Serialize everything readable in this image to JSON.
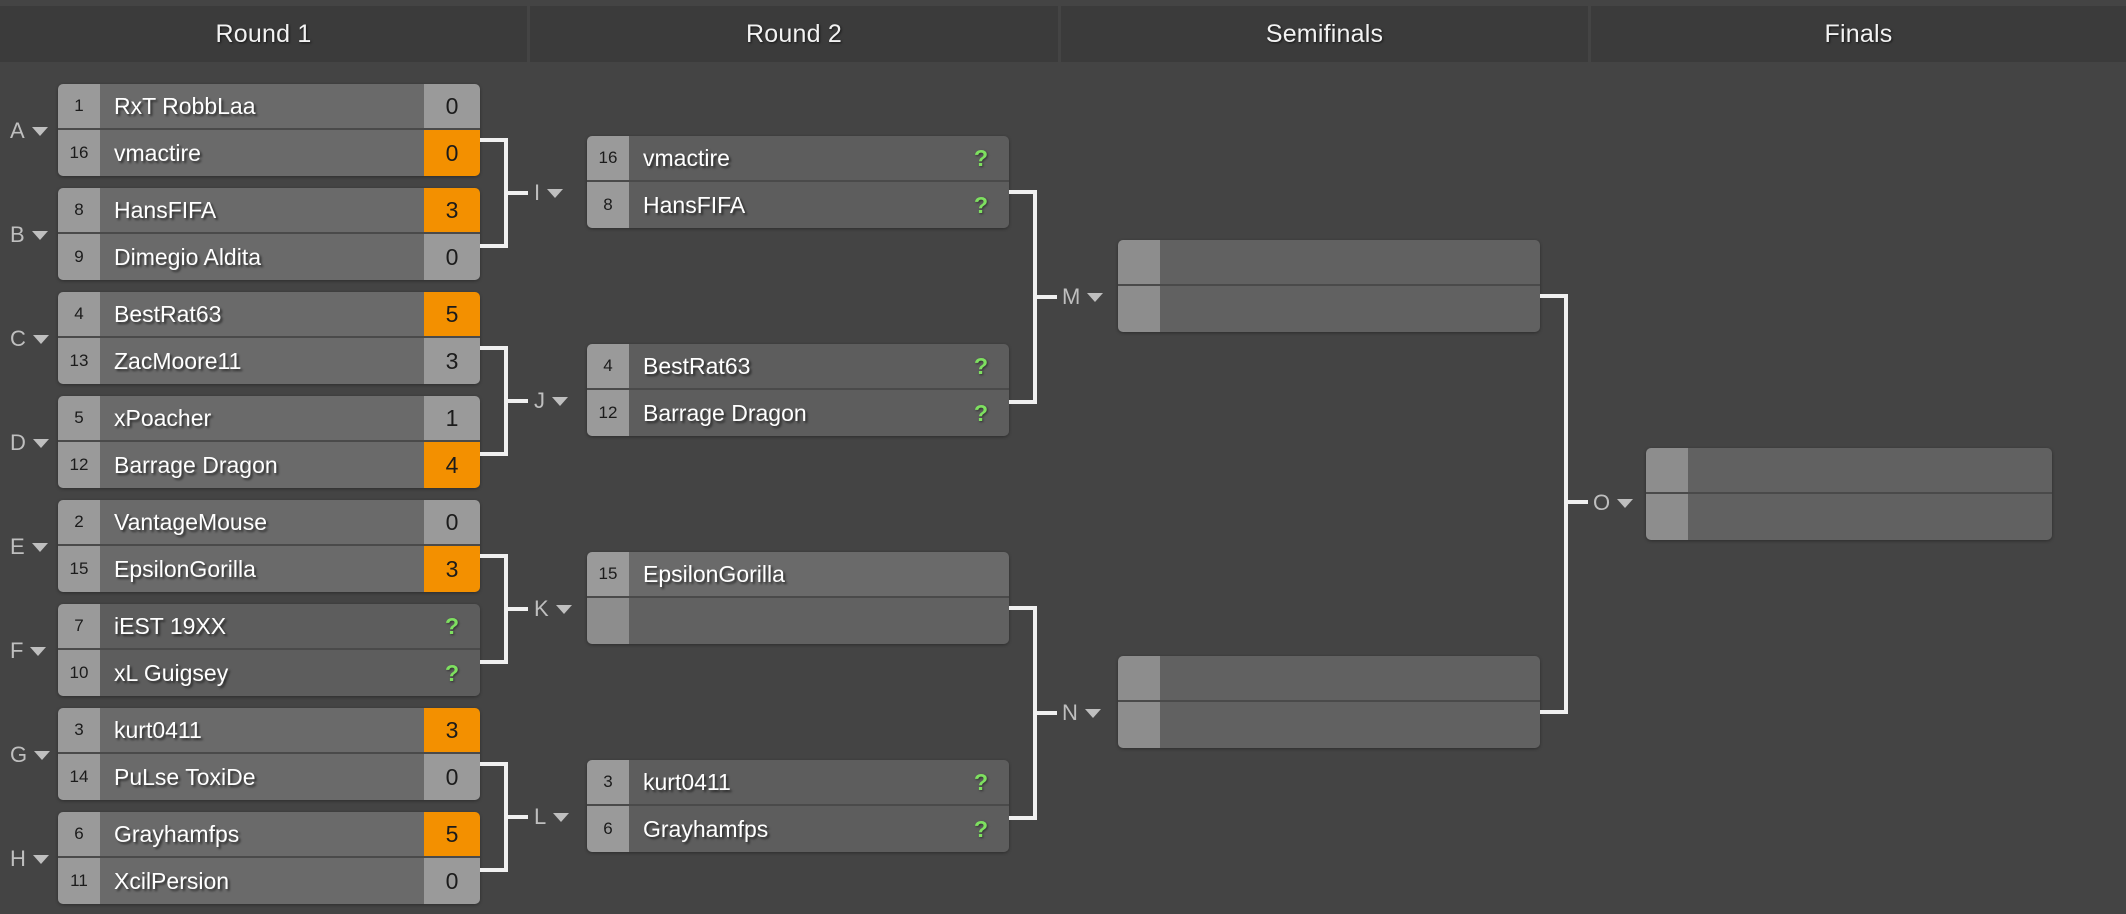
{
  "headers": [
    {
      "label": "Round 1"
    },
    {
      "label": "Round 2"
    },
    {
      "label": "Semifinals"
    },
    {
      "label": "Finals"
    }
  ],
  "group_labels": [
    {
      "letter": "A"
    },
    {
      "letter": "B"
    },
    {
      "letter": "C"
    },
    {
      "letter": "D"
    },
    {
      "letter": "E"
    },
    {
      "letter": "F"
    },
    {
      "letter": "G"
    },
    {
      "letter": "H"
    }
  ],
  "match_labels": [
    {
      "letter": "I"
    },
    {
      "letter": "J"
    },
    {
      "letter": "K"
    },
    {
      "letter": "L"
    },
    {
      "letter": "M"
    },
    {
      "letter": "N"
    },
    {
      "letter": "O"
    }
  ],
  "unknown_score": "?",
  "colors": {
    "page_background": "#444444",
    "header_background": "#3b3b3b",
    "seed_cell": "#9a9a9a",
    "name_cell": "#6a6a6a",
    "score_cell": "#9a9a9a",
    "winner_score": "#f39000",
    "pending_cell": "#5a5a5a",
    "pending_text": "#7ee060",
    "connector_line": "#f0f0f0",
    "label_text": "#bfbfbf"
  },
  "round1": {
    "matches": [
      {
        "group": "A",
        "top": {
          "seed": "1",
          "name": "RxT RobbLaa",
          "score": "0",
          "winner": false
        },
        "bottom": {
          "seed": "16",
          "name": "vmactire",
          "score": "0",
          "winner": true
        }
      },
      {
        "group": "B",
        "top": {
          "seed": "8",
          "name": "HansFIFA",
          "score": "3",
          "winner": true
        },
        "bottom": {
          "seed": "9",
          "name": "Dimegio Aldita",
          "score": "0",
          "winner": false
        }
      },
      {
        "group": "C",
        "top": {
          "seed": "4",
          "name": "BestRat63",
          "score": "5",
          "winner": true
        },
        "bottom": {
          "seed": "13",
          "name": "ZacMoore11",
          "score": "3",
          "winner": false
        }
      },
      {
        "group": "D",
        "top": {
          "seed": "5",
          "name": "xPoacher",
          "score": "1",
          "winner": false
        },
        "bottom": {
          "seed": "12",
          "name": "Barrage Dragon",
          "score": "4",
          "winner": true
        }
      },
      {
        "group": "E",
        "top": {
          "seed": "2",
          "name": "VantageMouse",
          "score": "0",
          "winner": false
        },
        "bottom": {
          "seed": "15",
          "name": "EpsilonGorilla",
          "score": "3",
          "winner": true
        }
      },
      {
        "group": "F",
        "top": {
          "seed": "7",
          "name": "iEST 19XX",
          "score": "?",
          "winner": false,
          "pending": true
        },
        "bottom": {
          "seed": "10",
          "name": "xL Guigsey",
          "score": "?",
          "winner": false,
          "pending": true
        }
      },
      {
        "group": "G",
        "top": {
          "seed": "3",
          "name": "kurt0411",
          "score": "3",
          "winner": true
        },
        "bottom": {
          "seed": "14",
          "name": "PuLse ToxiDe",
          "score": "0",
          "winner": false
        }
      },
      {
        "group": "H",
        "top": {
          "seed": "6",
          "name": "Grayhamfps",
          "score": "5",
          "winner": true
        },
        "bottom": {
          "seed": "11",
          "name": "XcilPersion",
          "score": "0",
          "winner": false
        }
      }
    ]
  },
  "round2": {
    "matches": [
      {
        "letter": "I",
        "top": {
          "seed": "16",
          "name": "vmactire",
          "score": "?",
          "pending": true
        },
        "bottom": {
          "seed": "8",
          "name": "HansFIFA",
          "score": "?",
          "pending": true
        }
      },
      {
        "letter": "J",
        "top": {
          "seed": "4",
          "name": "BestRat63",
          "score": "?",
          "pending": true
        },
        "bottom": {
          "seed": "12",
          "name": "Barrage Dragon",
          "score": "?",
          "pending": true
        }
      },
      {
        "letter": "K",
        "top": {
          "seed": "15",
          "name": "EpsilonGorilla",
          "score": "",
          "empty_score": true
        },
        "bottom": {
          "seed": "",
          "name": "",
          "score": "",
          "empty": true
        }
      },
      {
        "letter": "L",
        "top": {
          "seed": "3",
          "name": "kurt0411",
          "score": "?",
          "pending": true
        },
        "bottom": {
          "seed": "6",
          "name": "Grayhamfps",
          "score": "?",
          "pending": true
        }
      }
    ]
  },
  "semifinals": {
    "matches": [
      {
        "letter": "M",
        "top": {
          "seed": "",
          "name": "",
          "score": "",
          "empty": true
        },
        "bottom": {
          "seed": "",
          "name": "",
          "score": "",
          "empty": true
        }
      },
      {
        "letter": "N",
        "top": {
          "seed": "",
          "name": "",
          "score": "",
          "empty": true
        },
        "bottom": {
          "seed": "",
          "name": "",
          "score": "",
          "empty": true
        }
      }
    ]
  },
  "finals": {
    "matches": [
      {
        "letter": "O",
        "top": {
          "seed": "",
          "name": "",
          "score": "",
          "empty": true
        },
        "bottom": {
          "seed": "",
          "name": "",
          "score": "",
          "empty": true
        }
      }
    ]
  }
}
